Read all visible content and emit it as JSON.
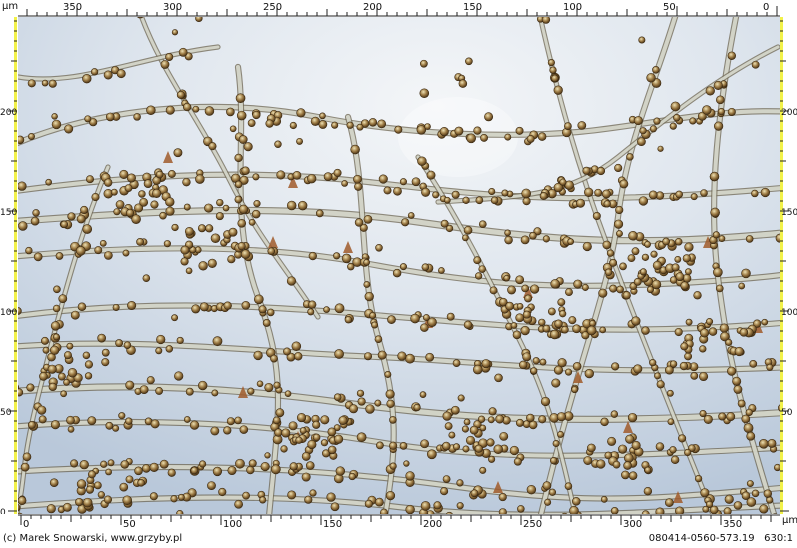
{
  "rulers": {
    "unit": "µm",
    "top_ticks": [
      "350",
      "300",
      "250",
      "200",
      "150",
      "100",
      "50",
      "0"
    ],
    "bottom_ticks": [
      "0",
      "50",
      "100",
      "150",
      "200",
      "250",
      "300",
      "350"
    ],
    "left_ticks": [
      "200",
      "150",
      "100",
      "50",
      "0"
    ],
    "right_ticks": [
      "200",
      "150",
      "100",
      "50"
    ]
  },
  "caption": {
    "credit": "(c) Marek Snowarski, www.grzyby.pl",
    "image_id": "080414-0560-573.19",
    "magnification": "630:1"
  },
  "colors": {
    "ruler_bg": "#ffffff",
    "ruler_tick": "#222222",
    "ruler_yellow": "#f2f24a",
    "background_light": "#eef2f6",
    "background_blue": "#b8c8da",
    "hypha_wall": "#6e6552",
    "hypha_fill": "#d9dccf",
    "spore": "#7a5a2c",
    "spore_highlight": "#e6d8a8",
    "crystal": "#a05a2a"
  },
  "scene": {
    "subject": "fungal hyphae with spores",
    "background": "pale blue-white bright field"
  }
}
